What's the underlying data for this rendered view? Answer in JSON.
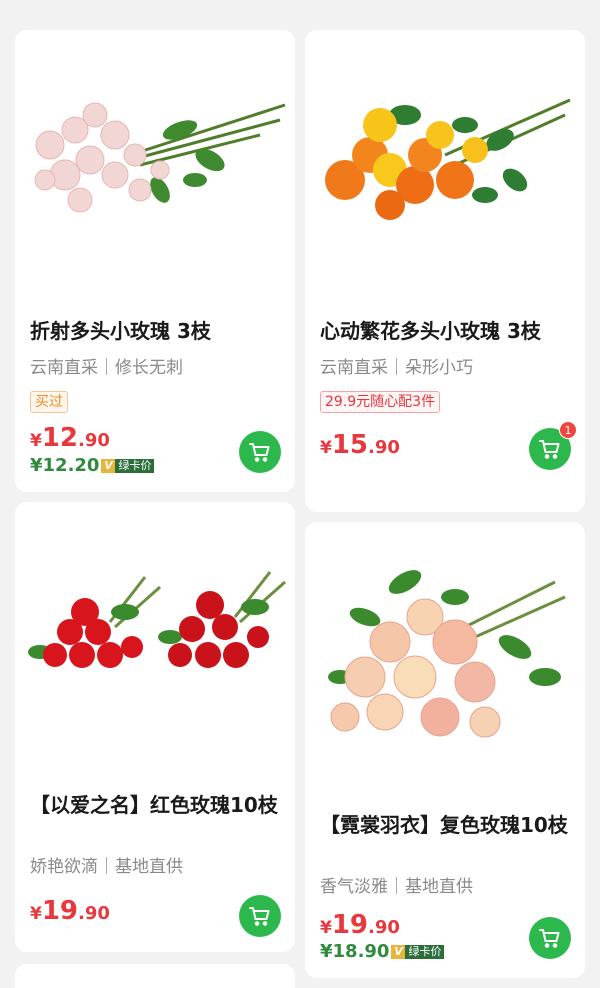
{
  "colors": {
    "price": "#e8373d",
    "vip": "#2f8a3e",
    "cart": "#2db84d",
    "background": "#f2f2f2"
  },
  "products": [
    {
      "title": "折射多头小玫瑰 3枝",
      "subtitle": "云南直采｜修长无刺",
      "tag": "买过",
      "price": {
        "symbol": "¥",
        "int": "12",
        "dec": ".90"
      },
      "vip_price": "¥12.20",
      "vip_v": "V",
      "vip_label": "绿卡价",
      "image": "pink-spray-roses-image"
    },
    {
      "title": "心动繁花多头小玫瑰 3枝",
      "subtitle": "云南直采｜朵形小巧",
      "tag": "29.9元随心配3件",
      "price": {
        "symbol": "¥",
        "int": "15",
        "dec": ".90"
      },
      "cart_badge": "1",
      "image": "orange-yellow-spray-roses-image"
    },
    {
      "title": "【以爱之名】红色玫瑰10枝",
      "subtitle": "娇艳欲滴｜基地直供",
      "price": {
        "symbol": "¥",
        "int": "19",
        "dec": ".90"
      },
      "image": "red-roses-bouquets-image"
    },
    {
      "title": "【霓裳羽衣】复色玫瑰10枝",
      "subtitle": "香气淡雅｜基地直供",
      "price": {
        "symbol": "¥",
        "int": "19",
        "dec": ".90"
      },
      "vip_price": "¥18.90",
      "vip_v": "V",
      "vip_label": "绿卡价",
      "image": "bicolor-roses-bouquet-image"
    }
  ]
}
